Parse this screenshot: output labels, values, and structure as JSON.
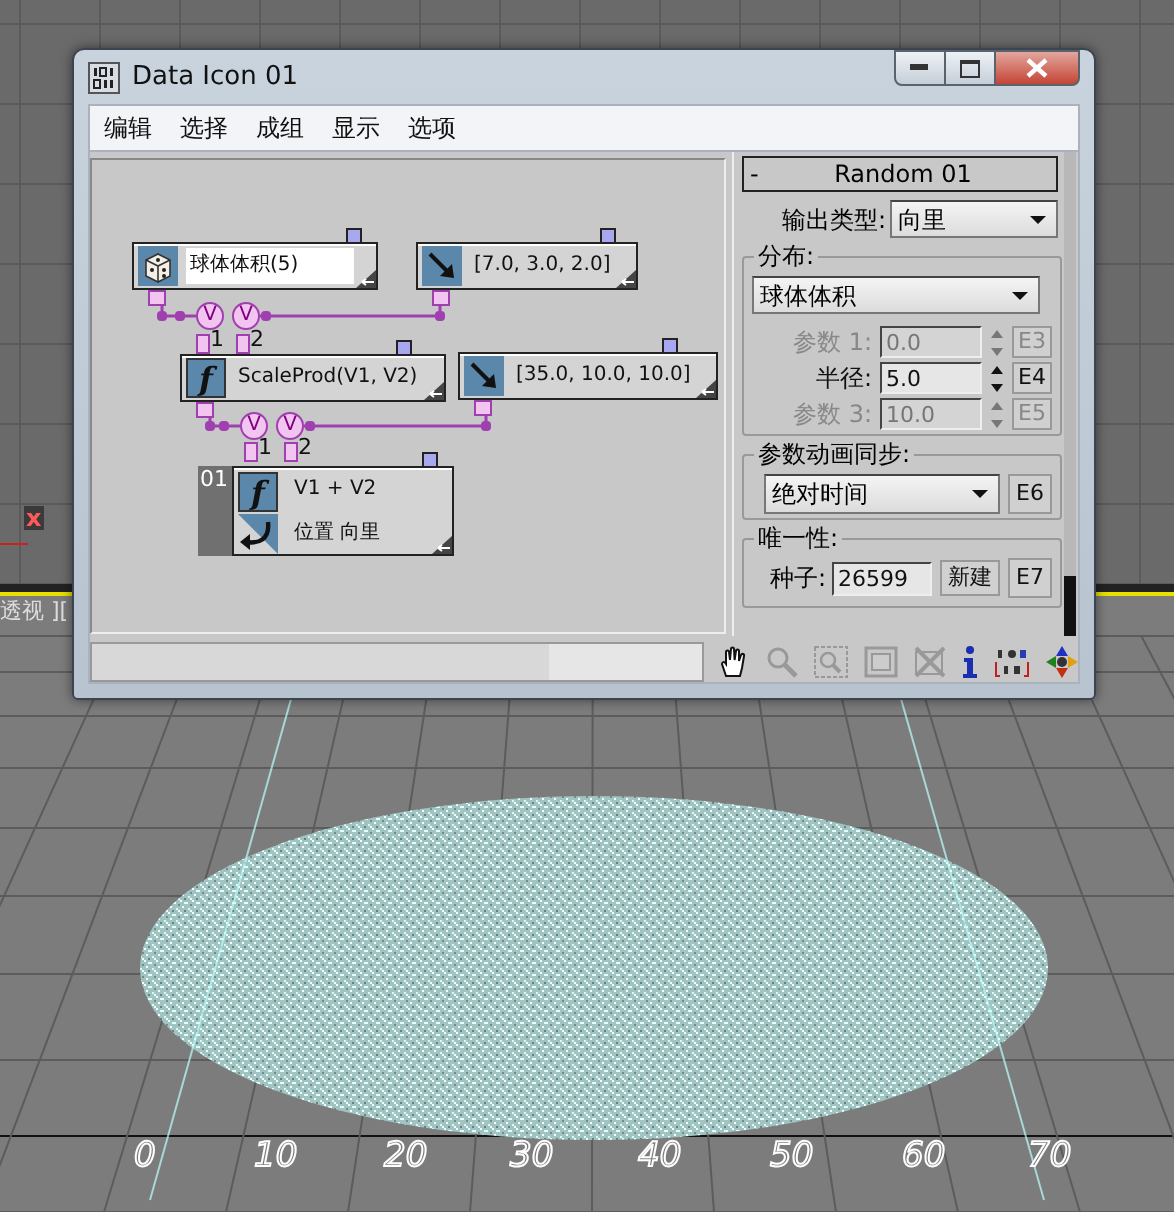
{
  "window": {
    "title": "Data Icon 01"
  },
  "menu": [
    {
      "label": "编辑"
    },
    {
      "label": "选择"
    },
    {
      "label": "成组"
    },
    {
      "label": "显示"
    },
    {
      "label": "选项"
    }
  ],
  "graph": {
    "nodes": [
      {
        "kind": "random",
        "label": "球体体积(5)",
        "selected": true
      },
      {
        "kind": "vector",
        "label": "[7.0, 3.0, 2.0]",
        "selected": false
      },
      {
        "kind": "function",
        "glyph": "f",
        "label": "ScaleProd(V1, V2)",
        "selected": false
      },
      {
        "kind": "vector",
        "label": "[35.0, 10.0, 10.0]",
        "selected": false
      },
      {
        "kind": "output",
        "index": "01",
        "glyph": "f",
        "label": "V1 + V2",
        "sublabel": "位置 向里"
      }
    ],
    "inputs": [
      {
        "ports": [
          {
            "symbol": "V",
            "number": "1"
          },
          {
            "symbol": "V",
            "number": "2"
          }
        ]
      },
      {
        "ports": [
          {
            "symbol": "V",
            "number": "1"
          },
          {
            "symbol": "V",
            "number": "2"
          }
        ]
      }
    ]
  },
  "panel": {
    "rollout_title": "Random 01",
    "collapse": "-",
    "expanded": true,
    "output_type": {
      "label": "输出类型:",
      "value": "向里"
    },
    "distribution": {
      "title": "分布:",
      "value": "球体体积",
      "params": [
        {
          "label": "参数 1:",
          "value": "0.0",
          "button": "E3",
          "disabled": true
        },
        {
          "label": "半径:",
          "value": "5.0",
          "button": "E4",
          "disabled": false
        },
        {
          "label": "参数 3:",
          "value": "10.0",
          "button": "E5",
          "disabled": true
        }
      ]
    },
    "sync": {
      "title": "参数动画同步:",
      "value": "绝对时间",
      "button": "E6"
    },
    "uniqueness": {
      "title": "唯一性:",
      "seed_label": "种子:",
      "seed": "26599",
      "new_button": "新建",
      "button": "E7"
    }
  },
  "viewport": {
    "axis_label": "x",
    "view_label": "透视 ][",
    "ruler": [
      "0",
      "10",
      "20",
      "30",
      "40",
      "50",
      "60",
      "70"
    ]
  }
}
